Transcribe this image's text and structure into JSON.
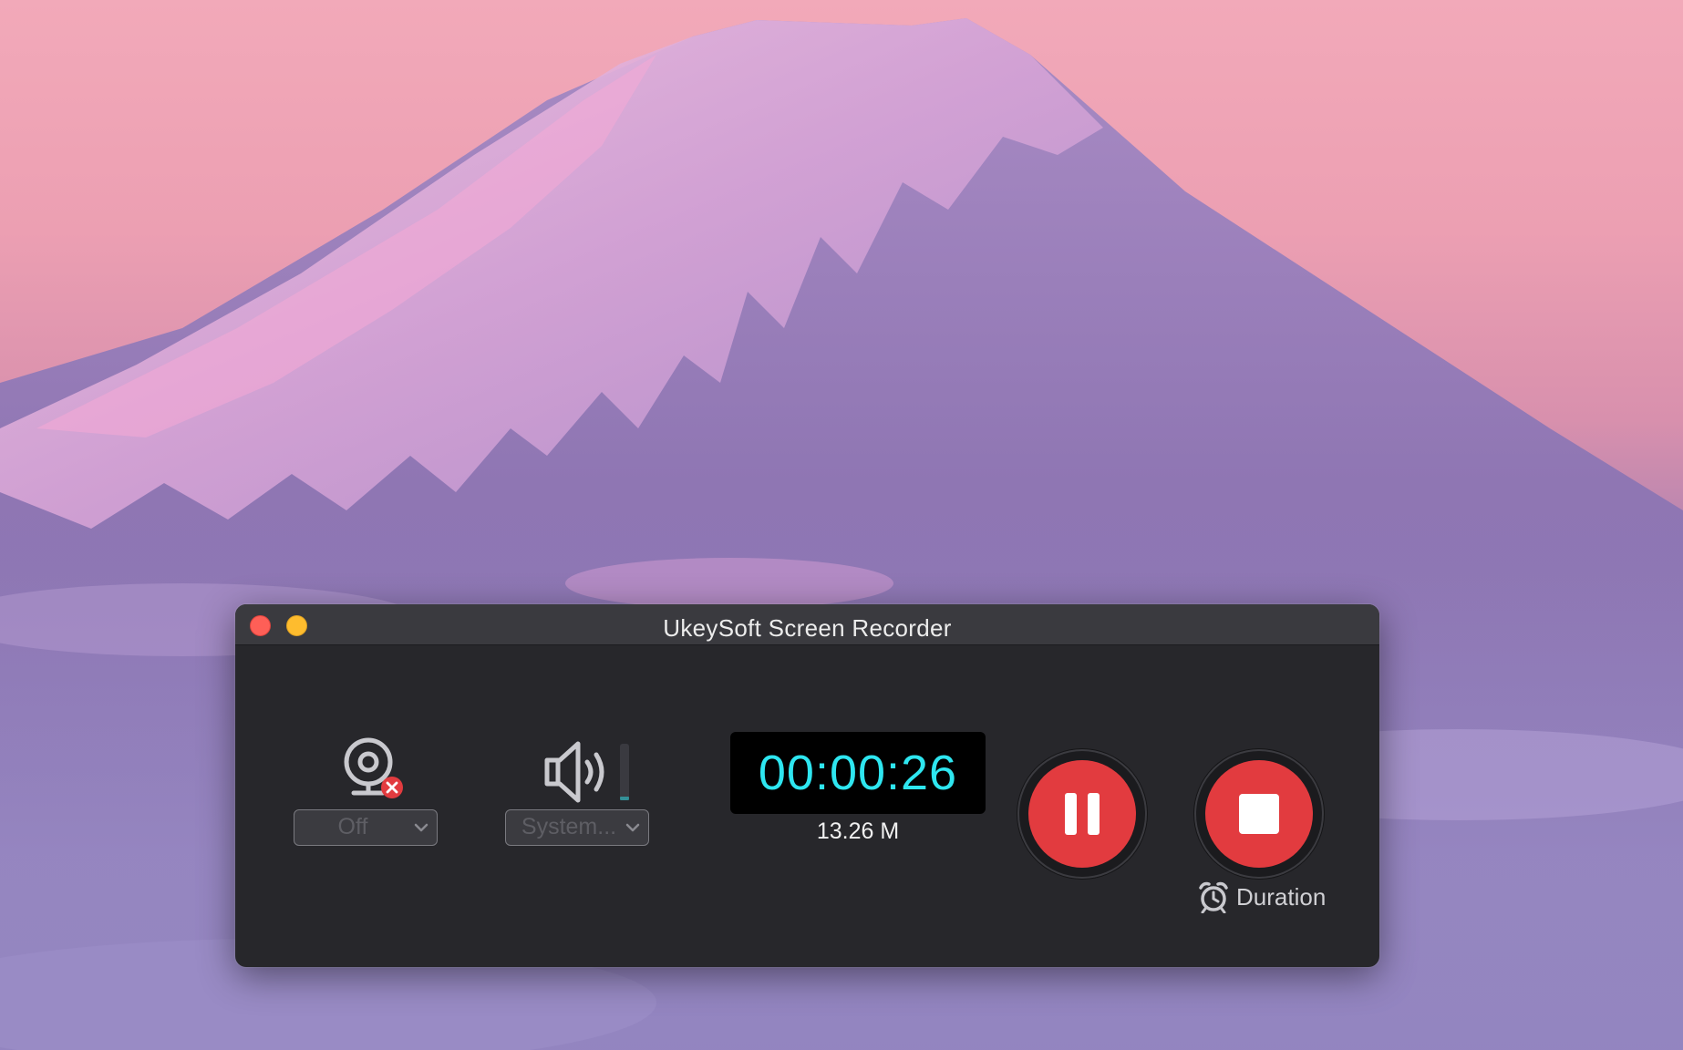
{
  "window": {
    "title": "UkeySoft Screen Recorder"
  },
  "webcam": {
    "icon": "webcam-off-icon",
    "select_value": "Off"
  },
  "audio": {
    "icon": "speaker-icon",
    "select_value": "System..."
  },
  "recording": {
    "elapsed": "00:00:26",
    "file_size": "13.26 M"
  },
  "controls": {
    "pause_icon": "pause-icon",
    "stop_icon": "stop-icon",
    "duration_label": "Duration",
    "duration_icon": "alarm-clock-icon"
  },
  "colors": {
    "timer_text": "#2ee6f0",
    "record_red": "#e23b3f",
    "window_bg": "#27272b",
    "titlebar_bg": "#3a3a3f"
  }
}
